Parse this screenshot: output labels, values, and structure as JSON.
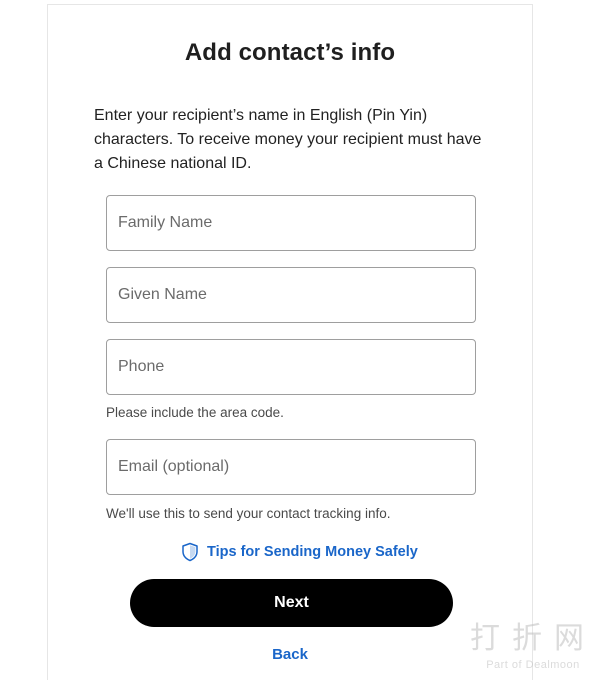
{
  "title": "Add contact’s info",
  "intro": "Enter your recipient’s name in English (Pin Yin) characters. To receive money your recipient must have a Chinese national ID.",
  "fields": {
    "family_name": {
      "placeholder": "Family Name",
      "value": ""
    },
    "given_name": {
      "placeholder": "Given Name",
      "value": ""
    },
    "phone": {
      "placeholder": "Phone",
      "value": "",
      "helper": "Please include the area code."
    },
    "email": {
      "placeholder": "Email (optional)",
      "value": "",
      "helper": "We'll use this to send your contact tracking info."
    }
  },
  "tips_link": {
    "label": "Tips for Sending Money Safely",
    "icon": "shield-icon"
  },
  "next_button": {
    "label": "Next"
  },
  "back_link": {
    "label": "Back"
  },
  "watermark": {
    "main": "打折网",
    "sub": "Part of Dealmoon"
  },
  "colors": {
    "link": "#1a66c9",
    "primary_button": "#000000",
    "field_border": "#9e9e9e"
  }
}
